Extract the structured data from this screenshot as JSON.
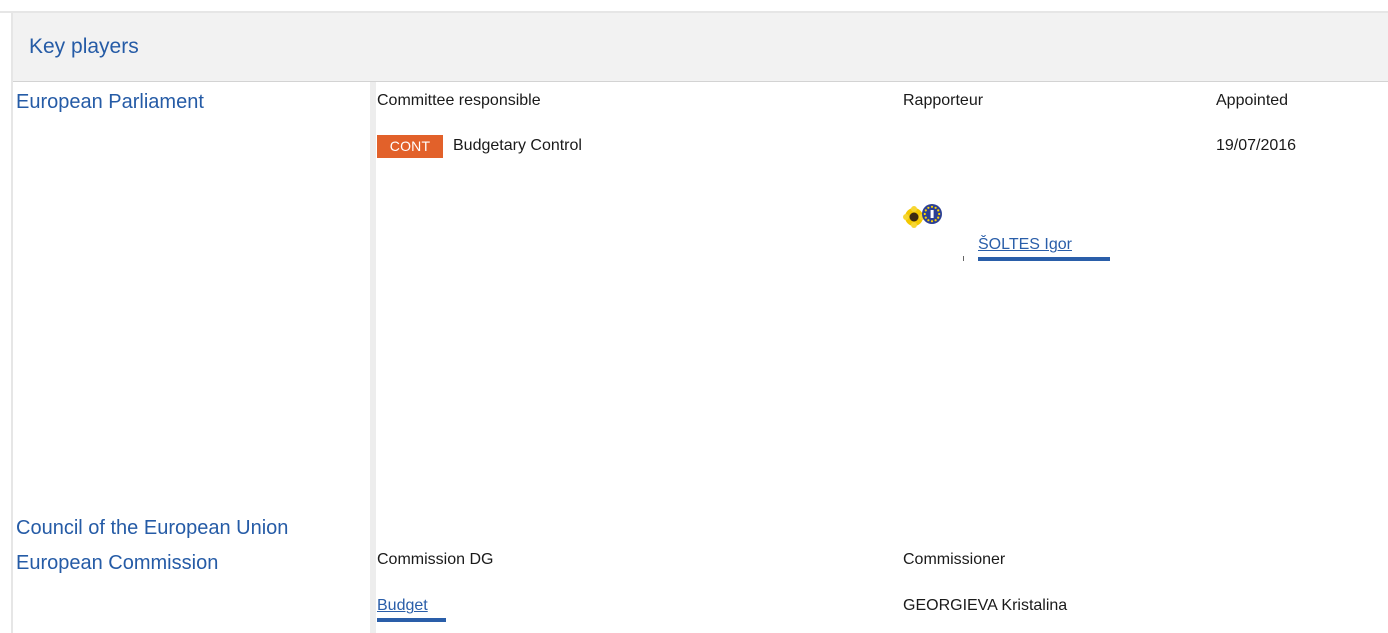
{
  "section": {
    "title": "Key players"
  },
  "european_parliament": {
    "label": "European Parliament",
    "columns": {
      "committee": "Committee responsible",
      "rapporteur": "Rapporteur",
      "appointed": "Appointed"
    },
    "committee": {
      "code": "CONT",
      "name": "Budgetary Control",
      "appointed_date": "19/07/2016"
    },
    "rapporteur": {
      "name": "ŠOLTES Igor",
      "group_logos": [
        "sunflower-icon",
        "eu-flag-icon"
      ]
    }
  },
  "council": {
    "label": "Council of the European Union"
  },
  "european_commission": {
    "label": "European Commission",
    "columns": {
      "dg": "Commission DG",
      "commissioner": "Commissioner"
    },
    "dg": "Budget",
    "commissioner": "GEORGIEVA Kristalina"
  },
  "colors": {
    "link": "#2a5ea9",
    "header_background": "#f2f2f2",
    "badge": "#e2612a"
  }
}
